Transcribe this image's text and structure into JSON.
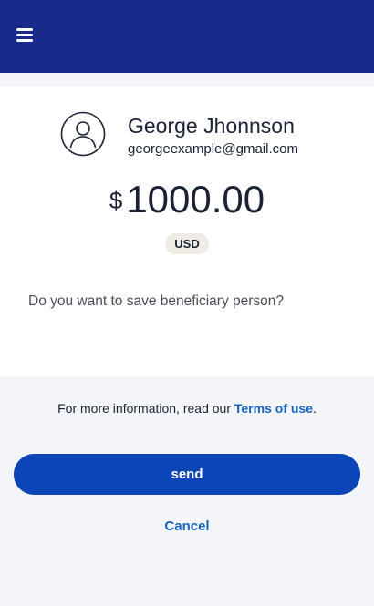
{
  "header": {
    "menu_icon": "hamburger-menu-icon",
    "background_color": "#1a2a8c"
  },
  "beneficiary": {
    "avatar_icon": "user-circle-icon",
    "name": "George Jhonnson",
    "email": "georgeexample@gmail.com"
  },
  "transfer": {
    "currency_symbol": "$",
    "amount": "1000.00",
    "currency_code": "USD"
  },
  "prompt": {
    "question": "Do you want to save beneficiary person?"
  },
  "footer": {
    "info_text": "For more information, read our ",
    "terms_link": "Terms of use",
    "info_suffix": ".",
    "send_label": "send",
    "cancel_label": "Cancel"
  },
  "colors": {
    "primary": "#0b45b8",
    "link": "#1565c0",
    "badge_bg": "#eeece4"
  }
}
